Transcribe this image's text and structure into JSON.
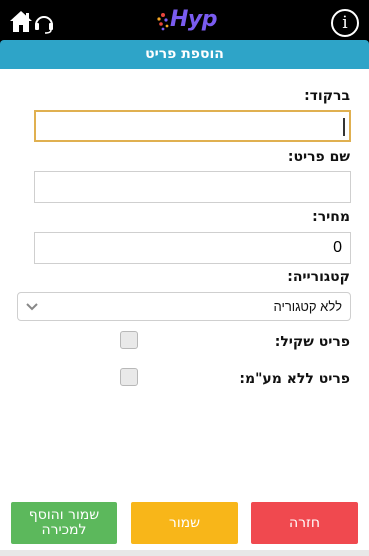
{
  "header": {
    "logo_text": "Hyp",
    "info_label": "i",
    "title": "הוספת פריט"
  },
  "form": {
    "barcode": {
      "label": "ברקוד:",
      "value": ""
    },
    "item_name": {
      "label": "שם פריט:",
      "value": ""
    },
    "price": {
      "label": "מחיר:",
      "value": "0"
    },
    "category": {
      "label": "קטגורייה:",
      "selected": "ללא קטגוריה"
    },
    "weighable": {
      "label": "פריט שקיל:",
      "checked": false
    },
    "no_vat": {
      "label": "פריט ללא מע\"מ:",
      "checked": false
    }
  },
  "actions": {
    "save_and_add": "שמור והוסף למכירה",
    "save": "שמור",
    "back": "חזרה"
  },
  "colors": {
    "topbar": "#000000",
    "titlebar": "#2ea4c8",
    "green": "#5cb85c",
    "yellow": "#f8b619",
    "red": "#f0494f",
    "logo": "#7a5cf0"
  },
  "icons": [
    "home-icon",
    "headset-icon",
    "info-icon",
    "chevron-down-icon"
  ]
}
